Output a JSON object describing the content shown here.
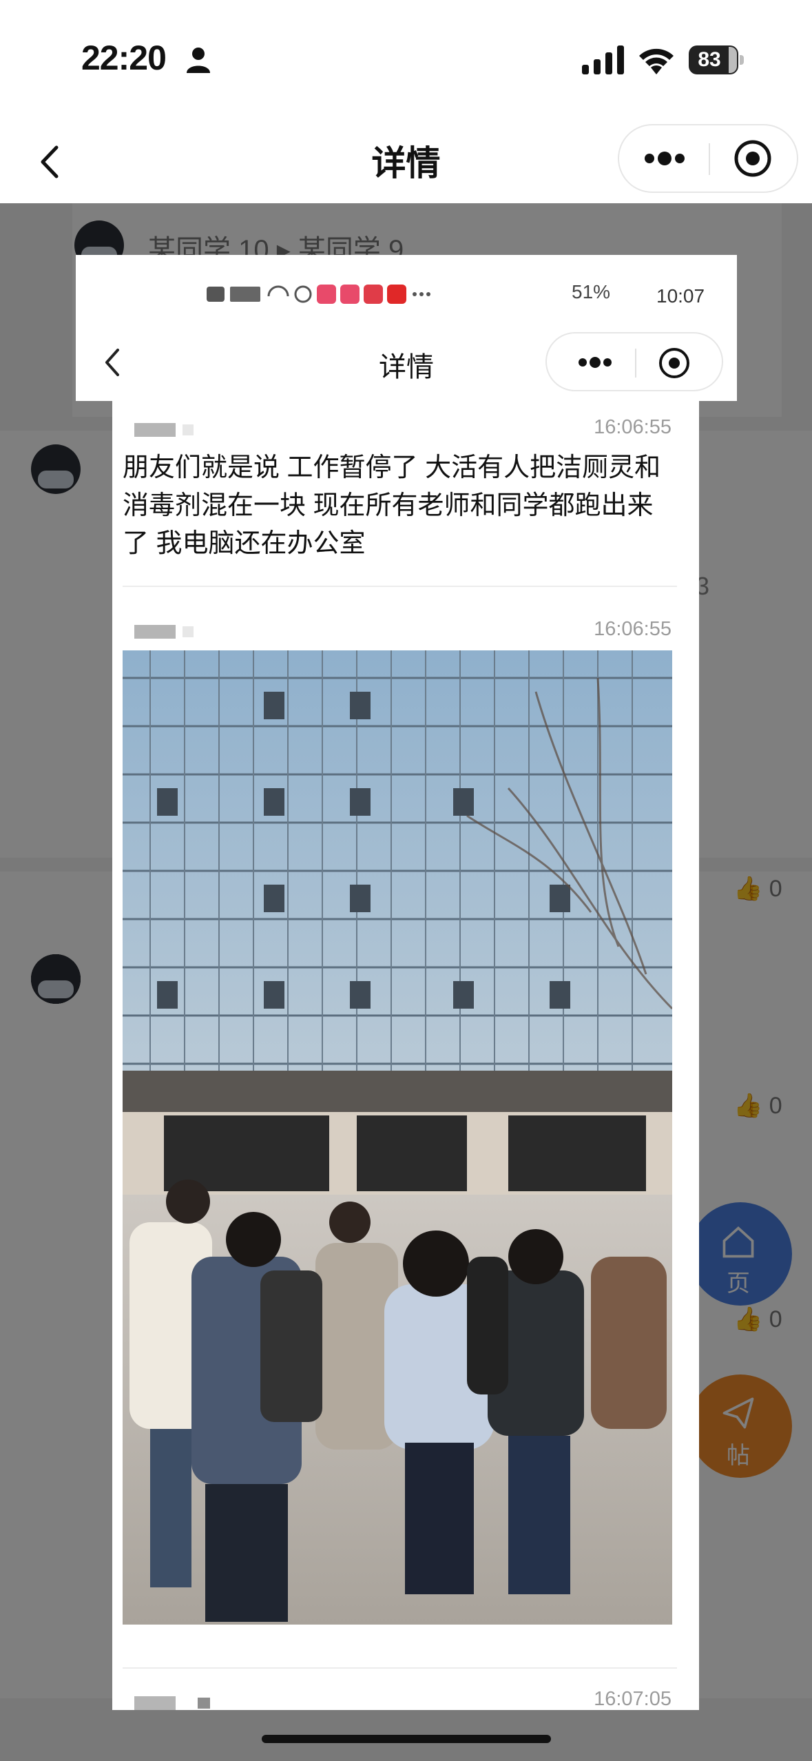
{
  "status_bar": {
    "time": "22:20",
    "battery": "83"
  },
  "nav": {
    "title": "详情"
  },
  "background": {
    "header_users": "某同学 10 ▸ 某同学 9",
    "like_count": "0",
    "right_num": "3",
    "float_buttons": [
      {
        "label": "页"
      },
      {
        "label": "帖"
      }
    ]
  },
  "inner_screenshot": {
    "status_right": "51%",
    "time": "10:07",
    "title": "详情",
    "messages": [
      {
        "time": "16:06:55",
        "text": "朋友们就是说 工作暂停了 大活有人把洁厕灵和消毒剂混在一块 现在所有老师和同学都跑出来了 我电脑还在办公室"
      },
      {
        "time": "16:06:55",
        "text": ""
      },
      {
        "time": "16:07:05",
        "text": ""
      }
    ]
  },
  "colors": {
    "dim": "#000000",
    "float_blue": "#4a7fe0",
    "float_orange": "#f08a2a"
  },
  "icons": [
    "person-icon",
    "signal-icon",
    "wifi-icon",
    "battery-icon",
    "back-icon",
    "more-icon",
    "close-miniprogram-icon",
    "like-icon",
    "home-icon",
    "post-icon"
  ]
}
